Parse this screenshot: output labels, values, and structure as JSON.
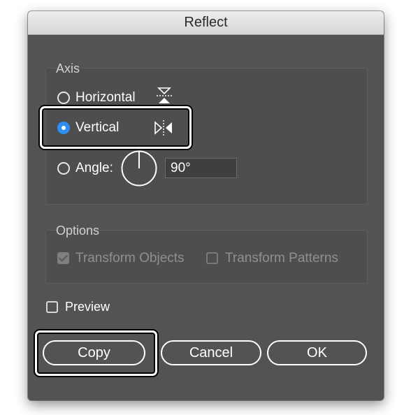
{
  "dialog": {
    "title": "Reflect",
    "axis": {
      "label": "Axis",
      "horizontal_label": "Horizontal",
      "vertical_label": "Vertical",
      "angle_label": "Angle:",
      "angle_value": "90°",
      "selected": "vertical"
    },
    "options": {
      "label": "Options",
      "transform_objects_label": "Transform Objects",
      "transform_patterns_label": "Transform Patterns",
      "transform_objects_checked": true,
      "transform_patterns_checked": false
    },
    "preview": {
      "label": "Preview",
      "checked": false
    },
    "buttons": {
      "copy": "Copy",
      "cancel": "Cancel",
      "ok": "OK"
    },
    "colors": {
      "accent": "#2e8ff2",
      "panel": "#535353"
    }
  }
}
